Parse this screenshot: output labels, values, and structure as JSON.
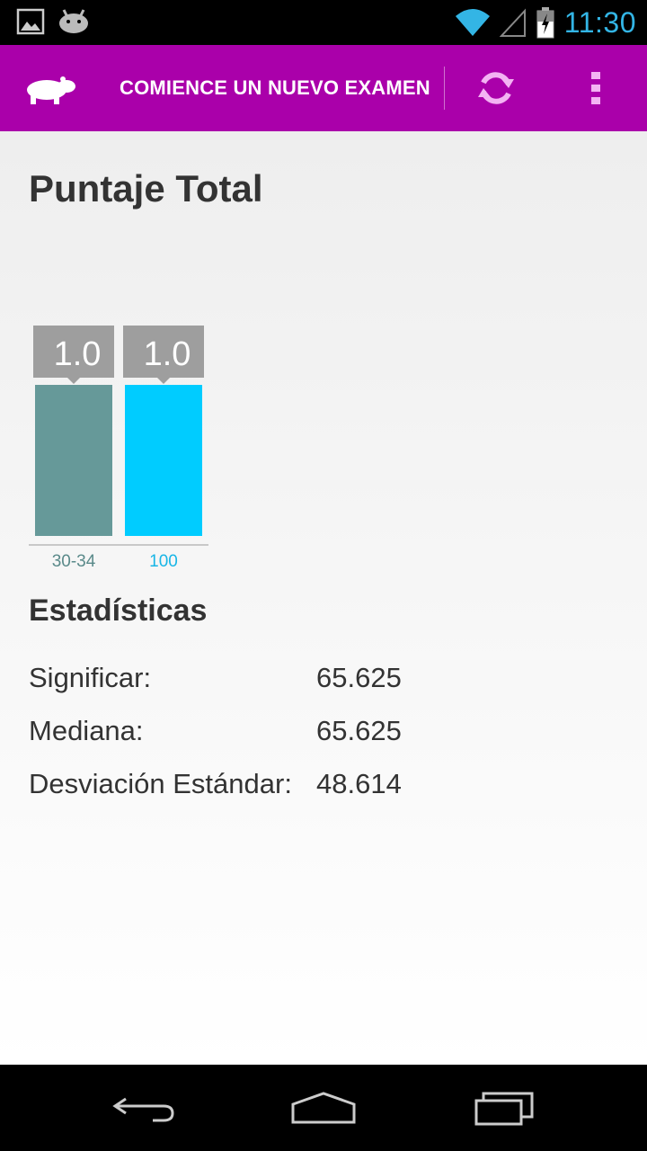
{
  "status_bar": {
    "time": "11:30",
    "icons": [
      "gallery-icon",
      "android-icon",
      "wifi-icon",
      "signal-icon",
      "battery-charging-icon"
    ]
  },
  "action_bar": {
    "title": "COMIENCE UN NUEVO EXAMEN",
    "logo_icon": "hippo-icon",
    "refresh_icon": "refresh-icon",
    "overflow_icon": "overflow-menu-icon",
    "color": "#aa00aa"
  },
  "page": {
    "title": "Puntaje Total"
  },
  "chart_data": {
    "type": "bar",
    "categories": [
      "30-34",
      "100"
    ],
    "values": [
      1.0,
      1.0
    ],
    "value_labels": [
      "1.0",
      "1.0"
    ],
    "colors": [
      "#669999",
      "#00ccff"
    ],
    "ylim": [
      0,
      1.0
    ]
  },
  "stats": {
    "title": "Estadísticas",
    "rows": [
      {
        "label": "Significar:",
        "value": "65.625"
      },
      {
        "label": "Mediana:",
        "value": "65.625"
      },
      {
        "label": "Desviación Estándar:",
        "value": "48.614"
      }
    ]
  },
  "nav_bar": {
    "icons": [
      "back-icon",
      "home-icon",
      "recent-apps-icon"
    ]
  }
}
